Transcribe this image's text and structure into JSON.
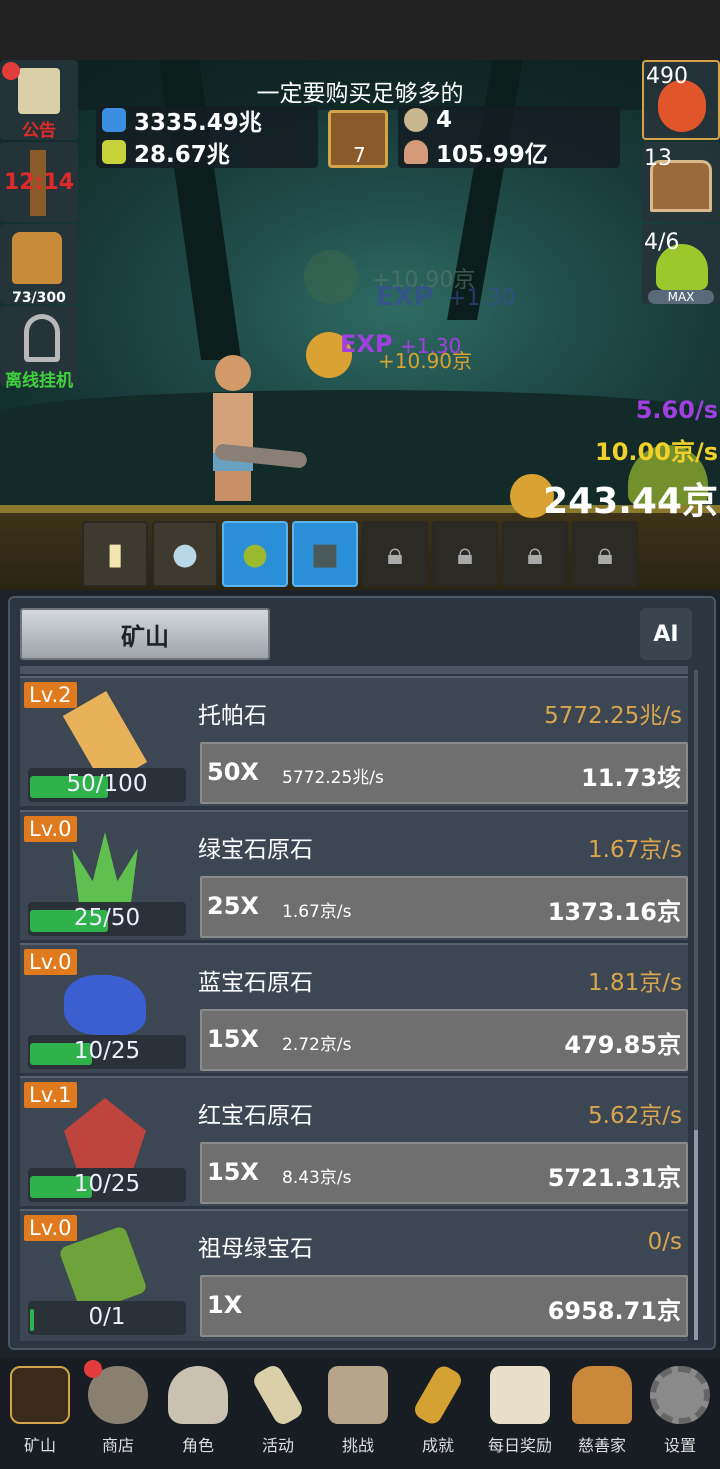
{
  "header": {
    "hint": "一定要购买足够多的"
  },
  "stats": {
    "blue_potion": "3335.49兆",
    "yellow_potion": "28.67兆",
    "book_count": "7",
    "coin_small": "4",
    "shell": "105.99亿"
  },
  "left_buttons": [
    {
      "label": "公告",
      "icon": "scroll-icon"
    },
    {
      "label": "12:14",
      "icon": "torch-icon"
    },
    {
      "label": "73/300",
      "icon": "beer-mug-icon"
    },
    {
      "label": "离线挂机",
      "icon": "key-icon"
    }
  ],
  "right_buttons": [
    {
      "label": "490",
      "icon": "health-potion-icon"
    },
    {
      "label": "13",
      "icon": "treasure-chest-icon"
    },
    {
      "label": "4/6",
      "sublabel": "MAX",
      "icon": "green-slime-icon"
    }
  ],
  "floating": {
    "coin_a": "+10.90京",
    "exp_a": "+1.30",
    "coin_b": "+10.90京",
    "exp_b": "+1.30",
    "exp_word": "EXP"
  },
  "rates": {
    "exp_rate": "5.60/s",
    "coin_rate": "10.00京/s",
    "total_coins": "243.44京"
  },
  "mine": {
    "tab_label": "矿山",
    "ai_label": "AI",
    "rows": [
      {
        "level": "Lv.2",
        "progress": "50/100",
        "fill": 0.5,
        "name": "托帕石",
        "rate": "5772.25兆/s",
        "mult": "50X",
        "small_rate": "5772.25兆/s",
        "cost": "11.73垓",
        "color": "#e8b25a"
      },
      {
        "level": "Lv.0",
        "progress": "25/50",
        "fill": 0.5,
        "name": "绿宝石原石",
        "rate": "1.67京/s",
        "mult": "25X",
        "small_rate": "1.67京/s",
        "cost": "1373.16京",
        "color": "#5fbf4f"
      },
      {
        "level": "Lv.0",
        "progress": "10/25",
        "fill": 0.4,
        "name": "蓝宝石原石",
        "rate": "1.81京/s",
        "mult": "15X",
        "small_rate": "2.72京/s",
        "cost": "479.85京",
        "color": "#3b5fd0"
      },
      {
        "level": "Lv.1",
        "progress": "10/25",
        "fill": 0.4,
        "name": "红宝石原石",
        "rate": "5.62京/s",
        "mult": "15X",
        "small_rate": "8.43京/s",
        "cost": "5721.31京",
        "color": "#c0443e"
      },
      {
        "level": "Lv.0",
        "progress": "0/1",
        "fill": 0.02,
        "name": "祖母绿宝石",
        "rate": "0/s",
        "mult": "1X",
        "small_rate": "",
        "cost": "6958.71京",
        "color": "#6da33a"
      }
    ]
  },
  "nav": [
    {
      "label": "矿山",
      "icon": "lantern-icon",
      "dot": false
    },
    {
      "label": "商店",
      "icon": "stone-tablet-icon",
      "dot": true
    },
    {
      "label": "角色",
      "icon": "skull-icon",
      "dot": false
    },
    {
      "label": "活动",
      "icon": "scroll-icon",
      "dot": false
    },
    {
      "label": "挑战",
      "icon": "map-icon",
      "dot": false
    },
    {
      "label": "成就",
      "icon": "golden-key-icon",
      "dot": false
    },
    {
      "label": "每日奖励",
      "icon": "envelope-icon",
      "dot": false
    },
    {
      "label": "慈善家",
      "icon": "bread-icon",
      "dot": false
    },
    {
      "label": "设置",
      "icon": "gear-icon",
      "dot": false
    }
  ]
}
